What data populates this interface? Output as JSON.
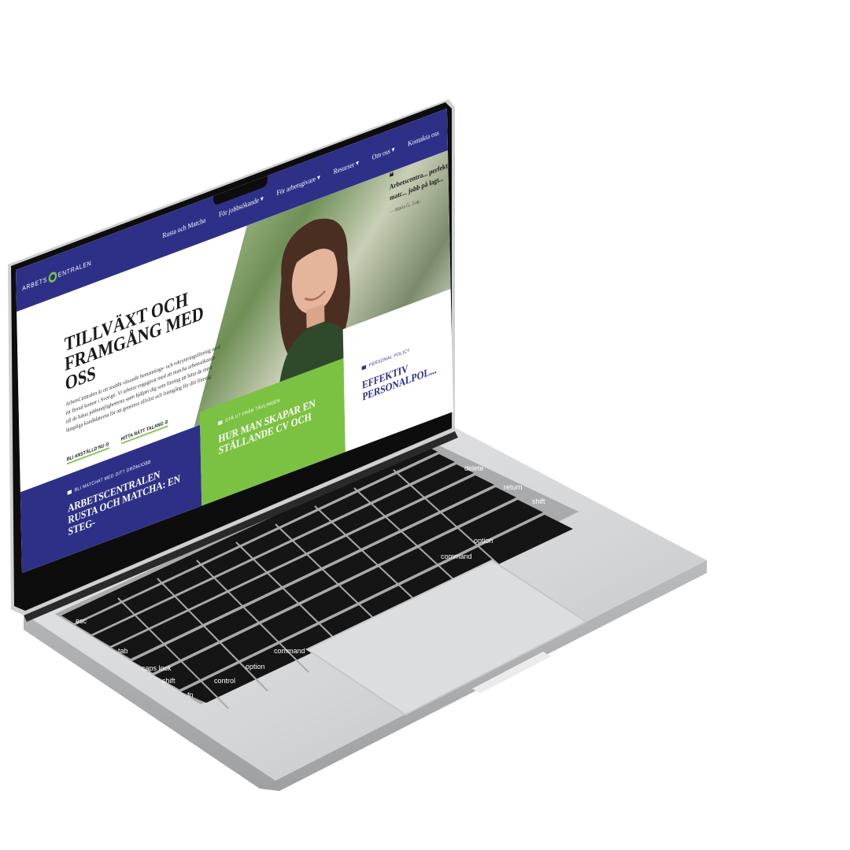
{
  "site": {
    "logo_text_left": "ARBETS",
    "logo_text_right": "ENTRALEN",
    "nav": [
      "Rusta och Matcha",
      "För jobbsökande ▾",
      "För arbetsgivare ▾",
      "Resurser ▾",
      "Om oss ▾",
      "Kontakta oss"
    ],
    "hero": {
      "title": "TILLVÄXT OCH FRAMGÅNG MED OSS",
      "lead": "ArbetsCentralen är ett snabbt växande bemannings- och rekryteringsföretag med ett flertal kontor i Sverige. Vi arbetar engagerat med att matcha arbetssökande till de bästa jobbmöjligheterna samt hjälper dig som företag att hitta de mest lämpliga kandidaterna för att generera tillväxt och framgång för ditt företag.",
      "cta_primary": "BLI ANSTÄLLD NU ⊙",
      "cta_secondary": "HITTA RÄTT TALANG ⊙"
    },
    "quote": {
      "text": "Arbetscentra... perfekt matc... jobb på lagt...",
      "author": "— Maria G., Lag..."
    },
    "tiles": [
      {
        "kicker": "BLI MATCHAT MED DITT DRÖMJOBB",
        "heading": "ARBETSCENTRALEN RUSTA OCH MATCHA: EN STEG-"
      },
      {
        "kicker": "STÅ UT FRÅN TÄVLINGEN",
        "heading": "HUR MAN SKAPAR EN STÄLLANDE CV OCH"
      },
      {
        "kicker": "PERSONAL POLICY",
        "heading": "EFFEKTIV PERSONALPOL..."
      }
    ]
  },
  "keyboard": {
    "keys_visible": [
      "esc",
      "tab",
      "caps lock",
      "shift",
      "fn",
      "control",
      "option",
      "command",
      "delete",
      "return",
      "shift",
      "option",
      "command"
    ]
  },
  "colors": {
    "brand_blue": "#2e3088",
    "brand_green": "#7cc242",
    "laptop_silver": "#c9cacc",
    "bezel": "#0d0d0d"
  }
}
